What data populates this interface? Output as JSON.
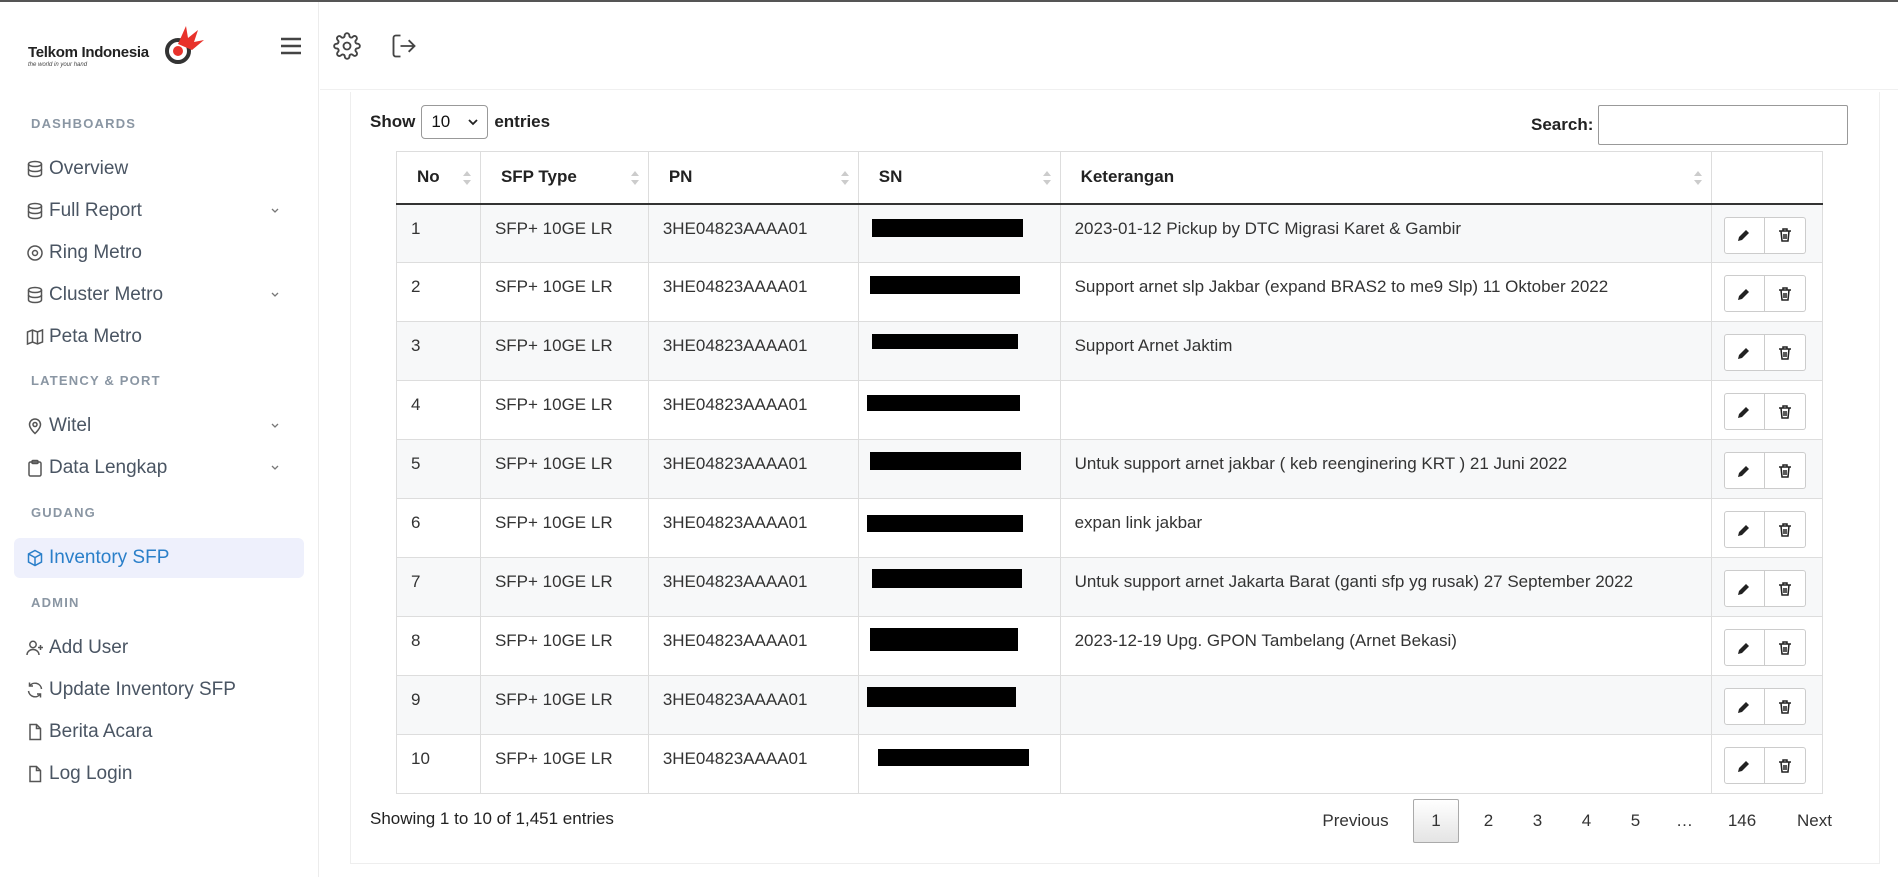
{
  "brand": {
    "name": "Telkom Indonesia",
    "tagline": "the world in your hand",
    "accent": "#e8322b"
  },
  "sidebar": {
    "sections": [
      {
        "title": "DASHBOARDS"
      },
      {
        "title": "LATENCY & PORT"
      },
      {
        "title": "GUDANG"
      },
      {
        "title": "ADMIN"
      }
    ],
    "items": [
      {
        "label": "Overview",
        "icon": "database-icon"
      },
      {
        "label": "Full Report",
        "icon": "database-icon"
      },
      {
        "label": "Ring Metro",
        "icon": "target-icon"
      },
      {
        "label": "Cluster Metro",
        "icon": "database-icon"
      },
      {
        "label": "Peta Metro",
        "icon": "map-icon"
      },
      {
        "label": "Witel",
        "icon": "location-pin-icon"
      },
      {
        "label": "Data Lengkap",
        "icon": "clipboard-icon"
      },
      {
        "label": "Inventory SFP",
        "icon": "box-icon"
      },
      {
        "label": "Add User",
        "icon": "user-plus-icon"
      },
      {
        "label": "Update Inventory SFP",
        "icon": "refresh-icon"
      },
      {
        "label": "Berita Acara",
        "icon": "file-icon"
      },
      {
        "label": "Log Login",
        "icon": "file-icon"
      }
    ]
  },
  "controls": {
    "show_label": "Show",
    "entries_label": "entries",
    "page_size": "10",
    "search_label": "Search:",
    "search_value": ""
  },
  "table": {
    "headers": [
      "No",
      "SFP Type",
      "PN",
      "SN",
      "Keterangan"
    ],
    "rows": [
      {
        "no": "1",
        "type": "SFP+ 10GE LR",
        "pn": "3HE04823AAAA01",
        "sn": "[redacted]",
        "ket": "2023-01-12 Pickup by DTC Migrasi Karet & Gambir"
      },
      {
        "no": "2",
        "type": "SFP+ 10GE LR",
        "pn": "3HE04823AAAA01",
        "sn": "[redacted]",
        "ket": "Support arnet slp Jakbar (expand BRAS2 to me9 Slp) 11 Oktober 2022"
      },
      {
        "no": "3",
        "type": "SFP+ 10GE LR",
        "pn": "3HE04823AAAA01",
        "sn": "[redacted]",
        "ket": "Support Arnet Jaktim"
      },
      {
        "no": "4",
        "type": "SFP+ 10GE LR",
        "pn": "3HE04823AAAA01",
        "sn": "[redacted]",
        "ket": ""
      },
      {
        "no": "5",
        "type": "SFP+ 10GE LR",
        "pn": "3HE04823AAAA01",
        "sn": "[redacted]",
        "ket": "Untuk support arnet jakbar ( keb reenginering KRT ) 21 Juni 2022"
      },
      {
        "no": "6",
        "type": "SFP+ 10GE LR",
        "pn": "3HE04823AAAA01",
        "sn": "[redacted]",
        "ket": "expan link jakbar"
      },
      {
        "no": "7",
        "type": "SFP+ 10GE LR",
        "pn": "3HE04823AAAA01",
        "sn": "[redacted]",
        "ket": "Untuk support arnet Jakarta Barat (ganti sfp yg rusak) 27 September 2022"
      },
      {
        "no": "8",
        "type": "SFP+ 10GE LR",
        "pn": "3HE04823AAAA01",
        "sn": "[redacted]",
        "ket": "2023-12-19 Upg. GPON Tambelang (Arnet Bekasi)"
      },
      {
        "no": "9",
        "type": "SFP+ 10GE LR",
        "pn": "3HE04823AAAA01",
        "sn": "[redacted]",
        "ket": ""
      },
      {
        "no": "10",
        "type": "SFP+ 10GE LR",
        "pn": "3HE04823AAAA01",
        "sn": "[redacted]",
        "ket": ""
      }
    ]
  },
  "footer": {
    "info": "Showing 1 to 10 of 1,451 entries",
    "pages": [
      "Previous",
      "1",
      "2",
      "3",
      "4",
      "5",
      "…",
      "146",
      "Next"
    ],
    "current_page": "1"
  }
}
